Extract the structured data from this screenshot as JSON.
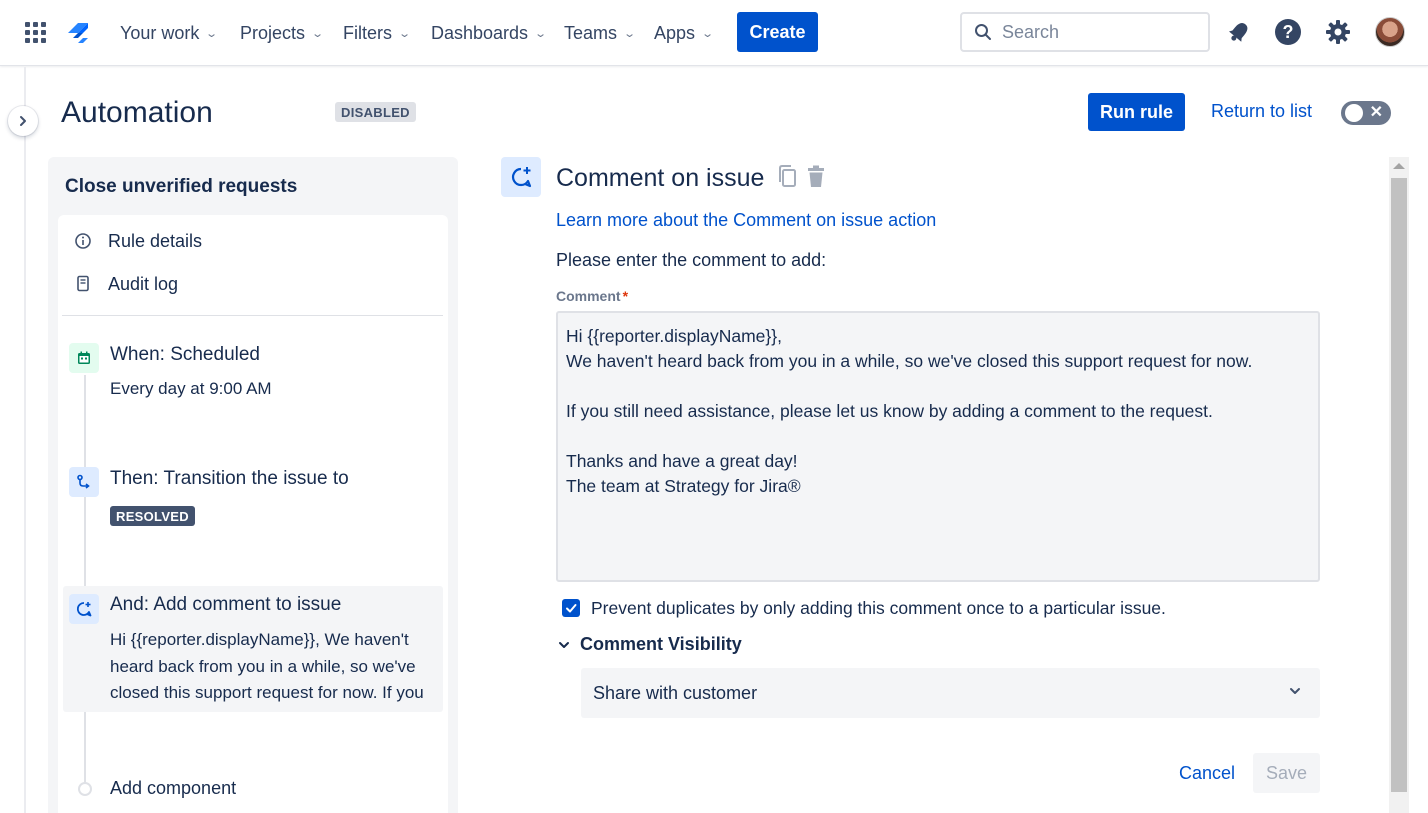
{
  "topnav": {
    "items": [
      {
        "label": "Your work"
      },
      {
        "label": "Projects"
      },
      {
        "label": "Filters"
      },
      {
        "label": "Dashboards"
      },
      {
        "label": "Teams"
      },
      {
        "label": "Apps"
      }
    ],
    "create_label": "Create",
    "search_placeholder": "Search",
    "icons": [
      "apps-grid-icon",
      "jira-logo-icon",
      "notifications-icon",
      "help-icon",
      "settings-icon",
      "avatar"
    ]
  },
  "header": {
    "title": "Automation",
    "status": "DISABLED",
    "run_rule": "Run rule",
    "return_to_list": "Return to list"
  },
  "rule": {
    "name": "Close unverified requests",
    "menu": [
      {
        "label": "Rule details",
        "icon": "info-icon"
      },
      {
        "label": "Audit log",
        "icon": "document-icon"
      }
    ],
    "steps": [
      {
        "title": "When: Scheduled",
        "subtitle": "Every day at 9:00 AM",
        "icon": "calendar-icon"
      },
      {
        "title": "Then: Transition the issue to",
        "lozenge": "RESOLVED",
        "icon": "transition-icon"
      },
      {
        "title": "And: Add comment to issue",
        "preview": "Hi {{reporter.displayName}}, We haven't heard back from you in a while, so we've closed this support request for now. If you",
        "icon": "comment-add-icon"
      }
    ],
    "add_component": "Add component"
  },
  "action": {
    "title": "Comment on issue",
    "learn_more": "Learn more about the Comment on issue action",
    "instruction": "Please enter the comment to add:",
    "comment_label": "Comment",
    "required_mark": "*",
    "comment_value": "Hi {{reporter.displayName}},\nWe haven't heard back from you in a while, so we've closed this support request for now.\n\nIf you still need assistance, please let us know by adding a comment to the request.\n\nThanks and have a great day!\nThe team at Strategy for Jira®",
    "prevent_duplicates_label": "Prevent duplicates by only adding this comment once to a particular issue.",
    "prevent_duplicates_checked": true,
    "visibility_label": "Comment Visibility",
    "visibility_value": "Share with customer",
    "cancel": "Cancel",
    "save": "Save"
  },
  "colors": {
    "primary": "#0052cc",
    "text": "#172b4d",
    "panel_bg": "#f4f5f7",
    "resolved_lozenge": "#42526e",
    "disabled_lozenge": "#dfe1e6"
  }
}
